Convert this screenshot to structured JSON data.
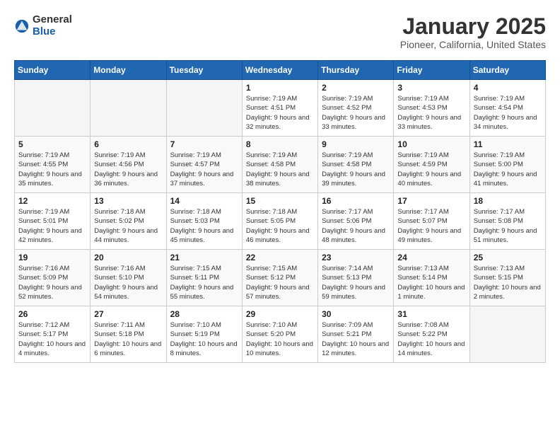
{
  "logo": {
    "general": "General",
    "blue": "Blue"
  },
  "title": "January 2025",
  "subtitle": "Pioneer, California, United States",
  "days_of_week": [
    "Sunday",
    "Monday",
    "Tuesday",
    "Wednesday",
    "Thursday",
    "Friday",
    "Saturday"
  ],
  "weeks": [
    [
      {
        "day": "",
        "info": ""
      },
      {
        "day": "",
        "info": ""
      },
      {
        "day": "",
        "info": ""
      },
      {
        "day": "1",
        "info": "Sunrise: 7:19 AM\nSunset: 4:51 PM\nDaylight: 9 hours and 32 minutes."
      },
      {
        "day": "2",
        "info": "Sunrise: 7:19 AM\nSunset: 4:52 PM\nDaylight: 9 hours and 33 minutes."
      },
      {
        "day": "3",
        "info": "Sunrise: 7:19 AM\nSunset: 4:53 PM\nDaylight: 9 hours and 33 minutes."
      },
      {
        "day": "4",
        "info": "Sunrise: 7:19 AM\nSunset: 4:54 PM\nDaylight: 9 hours and 34 minutes."
      }
    ],
    [
      {
        "day": "5",
        "info": "Sunrise: 7:19 AM\nSunset: 4:55 PM\nDaylight: 9 hours and 35 minutes."
      },
      {
        "day": "6",
        "info": "Sunrise: 7:19 AM\nSunset: 4:56 PM\nDaylight: 9 hours and 36 minutes."
      },
      {
        "day": "7",
        "info": "Sunrise: 7:19 AM\nSunset: 4:57 PM\nDaylight: 9 hours and 37 minutes."
      },
      {
        "day": "8",
        "info": "Sunrise: 7:19 AM\nSunset: 4:58 PM\nDaylight: 9 hours and 38 minutes."
      },
      {
        "day": "9",
        "info": "Sunrise: 7:19 AM\nSunset: 4:58 PM\nDaylight: 9 hours and 39 minutes."
      },
      {
        "day": "10",
        "info": "Sunrise: 7:19 AM\nSunset: 4:59 PM\nDaylight: 9 hours and 40 minutes."
      },
      {
        "day": "11",
        "info": "Sunrise: 7:19 AM\nSunset: 5:00 PM\nDaylight: 9 hours and 41 minutes."
      }
    ],
    [
      {
        "day": "12",
        "info": "Sunrise: 7:19 AM\nSunset: 5:01 PM\nDaylight: 9 hours and 42 minutes."
      },
      {
        "day": "13",
        "info": "Sunrise: 7:18 AM\nSunset: 5:02 PM\nDaylight: 9 hours and 44 minutes."
      },
      {
        "day": "14",
        "info": "Sunrise: 7:18 AM\nSunset: 5:03 PM\nDaylight: 9 hours and 45 minutes."
      },
      {
        "day": "15",
        "info": "Sunrise: 7:18 AM\nSunset: 5:05 PM\nDaylight: 9 hours and 46 minutes."
      },
      {
        "day": "16",
        "info": "Sunrise: 7:17 AM\nSunset: 5:06 PM\nDaylight: 9 hours and 48 minutes."
      },
      {
        "day": "17",
        "info": "Sunrise: 7:17 AM\nSunset: 5:07 PM\nDaylight: 9 hours and 49 minutes."
      },
      {
        "day": "18",
        "info": "Sunrise: 7:17 AM\nSunset: 5:08 PM\nDaylight: 9 hours and 51 minutes."
      }
    ],
    [
      {
        "day": "19",
        "info": "Sunrise: 7:16 AM\nSunset: 5:09 PM\nDaylight: 9 hours and 52 minutes."
      },
      {
        "day": "20",
        "info": "Sunrise: 7:16 AM\nSunset: 5:10 PM\nDaylight: 9 hours and 54 minutes."
      },
      {
        "day": "21",
        "info": "Sunrise: 7:15 AM\nSunset: 5:11 PM\nDaylight: 9 hours and 55 minutes."
      },
      {
        "day": "22",
        "info": "Sunrise: 7:15 AM\nSunset: 5:12 PM\nDaylight: 9 hours and 57 minutes."
      },
      {
        "day": "23",
        "info": "Sunrise: 7:14 AM\nSunset: 5:13 PM\nDaylight: 9 hours and 59 minutes."
      },
      {
        "day": "24",
        "info": "Sunrise: 7:13 AM\nSunset: 5:14 PM\nDaylight: 10 hours and 1 minute."
      },
      {
        "day": "25",
        "info": "Sunrise: 7:13 AM\nSunset: 5:15 PM\nDaylight: 10 hours and 2 minutes."
      }
    ],
    [
      {
        "day": "26",
        "info": "Sunrise: 7:12 AM\nSunset: 5:17 PM\nDaylight: 10 hours and 4 minutes."
      },
      {
        "day": "27",
        "info": "Sunrise: 7:11 AM\nSunset: 5:18 PM\nDaylight: 10 hours and 6 minutes."
      },
      {
        "day": "28",
        "info": "Sunrise: 7:10 AM\nSunset: 5:19 PM\nDaylight: 10 hours and 8 minutes."
      },
      {
        "day": "29",
        "info": "Sunrise: 7:10 AM\nSunset: 5:20 PM\nDaylight: 10 hours and 10 minutes."
      },
      {
        "day": "30",
        "info": "Sunrise: 7:09 AM\nSunset: 5:21 PM\nDaylight: 10 hours and 12 minutes."
      },
      {
        "day": "31",
        "info": "Sunrise: 7:08 AM\nSunset: 5:22 PM\nDaylight: 10 hours and 14 minutes."
      },
      {
        "day": "",
        "info": ""
      }
    ]
  ]
}
